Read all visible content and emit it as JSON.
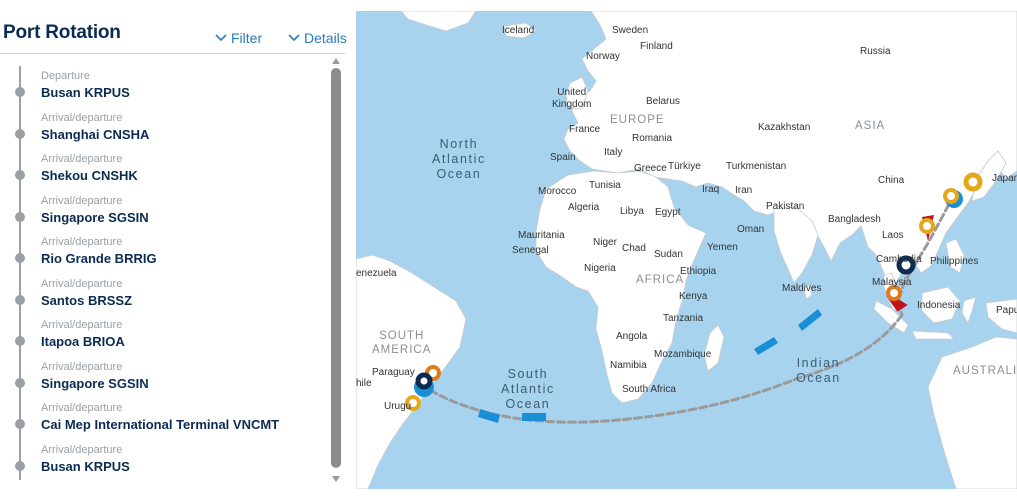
{
  "panel": {
    "title": "Port Rotation",
    "filter_label": "Filter",
    "details_label": "Details"
  },
  "stops": [
    {
      "type": "Departure",
      "port": "Busan  KRPUS"
    },
    {
      "type": "Arrival/departure",
      "port": "Shanghai  CNSHA"
    },
    {
      "type": "Arrival/departure",
      "port": "Shekou  CNSHK"
    },
    {
      "type": "Arrival/departure",
      "port": "Singapore  SGSIN"
    },
    {
      "type": "Arrival/departure",
      "port": "Rio Grande  BRRIG"
    },
    {
      "type": "Arrival/departure",
      "port": "Santos  BRSSZ"
    },
    {
      "type": "Arrival/departure",
      "port": "Itapoa  BRIOA"
    },
    {
      "type": "Arrival/departure",
      "port": "Singapore  SGSIN"
    },
    {
      "type": "Arrival/departure",
      "port": "Cai Mep International Terminal  VNCMT"
    },
    {
      "type": "Arrival/departure",
      "port": "Busan  KRPUS"
    }
  ],
  "map": {
    "oceans": {
      "north_atlantic": "North\nAtlantic\nOcean",
      "south_atlantic": "South\nAtlantic\nOcean",
      "indian": "Indian\nOcean"
    },
    "regions": {
      "europe": "EUROPE",
      "asia": "ASIA",
      "africa": "AFRICA",
      "south_america": "SOUTH\nAMERICA",
      "australia": "AUSTRALIA"
    },
    "countries": {
      "iceland": "Iceland",
      "sweden": "Sweden",
      "finland": "Finland",
      "norway": "Norway",
      "russia": "Russia",
      "united_kingdom": "United\nKingdom",
      "belarus": "Belarus",
      "france": "France",
      "romania": "Romania",
      "kazakhstan": "Kazakhstan",
      "spain": "Spain",
      "italy": "Italy",
      "turkiye": "Türkiye",
      "turkmenistan": "Turkmenistan",
      "greece": "Greece",
      "china": "China",
      "japan": "Japan",
      "tunisia": "Tunisia",
      "morocco": "Morocco",
      "iraq": "Iraq",
      "iran": "Iran",
      "algeria": "Algeria",
      "libya": "Libya",
      "egypt": "Egypt",
      "pakistan": "Pakistan",
      "bangladesh": "Bangladesh",
      "oman": "Oman",
      "mauritania": "Mauritania",
      "niger": "Niger",
      "chad": "Chad",
      "senegal": "Senegal",
      "sudan": "Sudan",
      "yemen": "Yemen",
      "laos": "Laos",
      "nigeria": "Nigeria",
      "ethiopia": "Ethiopia",
      "cambodia": "Cambodia",
      "philippines": "Philippines",
      "venezuela": "enezuela",
      "maldives": "Maldives",
      "malaysia": "Malaysia",
      "kenya": "Kenya",
      "indonesia": "Indonesia",
      "tanzania": "Tanzania",
      "papua": "Papu",
      "angola": "Angola",
      "mozambique": "Mozambique",
      "namibia": "Namibia",
      "paraguay": "Paraguay",
      "south_africa": "South Africa",
      "chile": "hile",
      "uruguay": "Urugu"
    }
  },
  "colors": {
    "title": "#0b2b52",
    "link": "#2c7bbf",
    "timeline": "#9aa0a6",
    "water": "#a7d3ee",
    "land": "#ffffff",
    "route": "#9a9a9a",
    "vessel": "#1a8fd6",
    "marker_orange": "#e07a1f",
    "marker_yellow": "#e4a81b",
    "marker_navy": "#0b2b52",
    "marker_blue": "#1a8fd6",
    "marker_red": "#c0141b"
  }
}
